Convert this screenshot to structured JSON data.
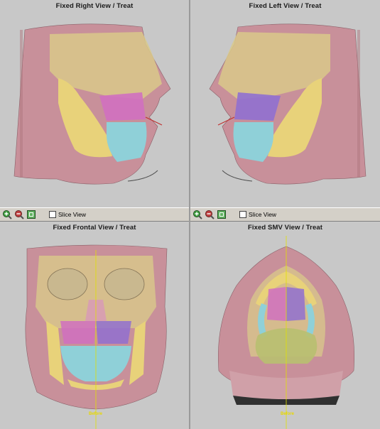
{
  "views": {
    "top_left": {
      "title": "Fixed Right View / Treat"
    },
    "top_right": {
      "title": "Fixed Left View / Treat"
    },
    "bottom_left": {
      "title": "Fixed Frontal View / Treat",
      "marker": "Before"
    },
    "bottom_right": {
      "title": "Fixed SMV View / Treat",
      "marker": "Before"
    }
  },
  "toolbar": {
    "slice_view_label": "Slice View",
    "slice_view_checked": false,
    "buttons": [
      "zoom-in-icon",
      "zoom-out-icon",
      "fit-view-icon"
    ]
  },
  "colors": {
    "skin": "#c8909a",
    "bone": "#d9c98a",
    "mandible": "#e8d27a",
    "maxilla_magenta": "#d070c0",
    "teeth_cyan": "#8fd0d8",
    "purple": "#9070d0",
    "guide_yellow": "#e0e000"
  }
}
